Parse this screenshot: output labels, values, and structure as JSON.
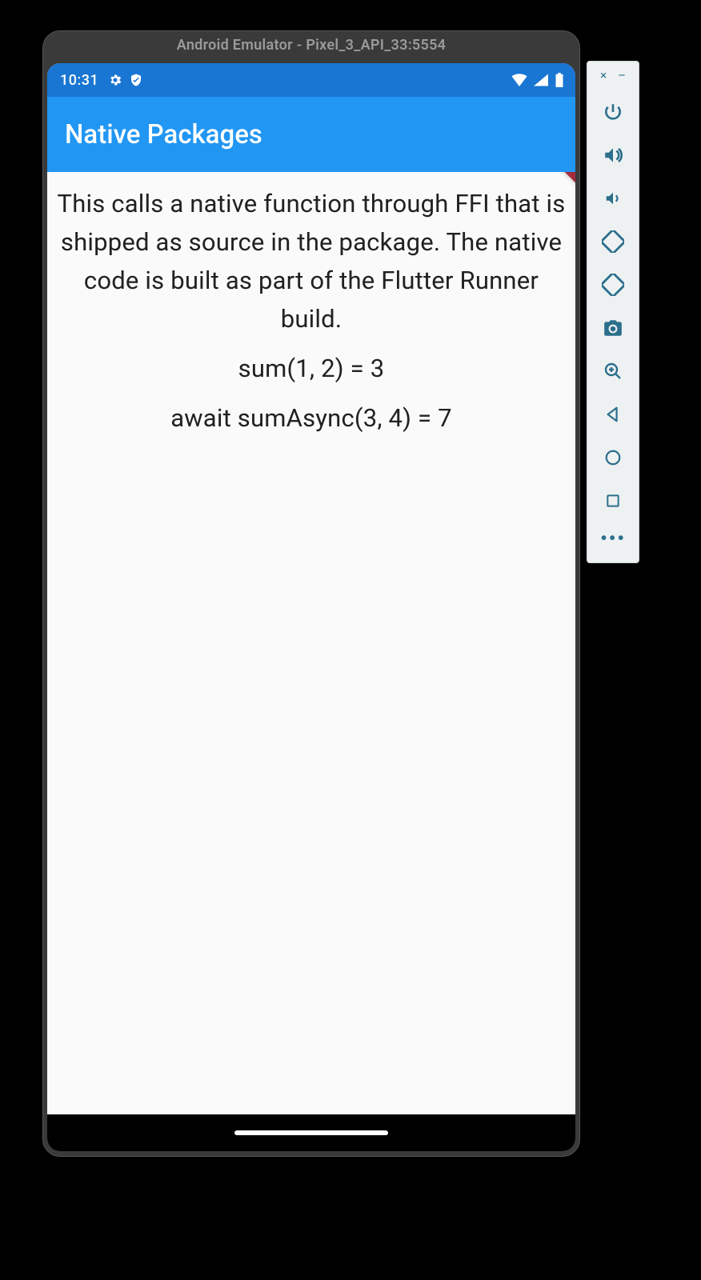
{
  "emulator": {
    "title": "Android Emulator - Pixel_3_API_33:5554",
    "toolbar": {
      "close": "×",
      "minimize": "–"
    }
  },
  "status_bar": {
    "time": "10:31"
  },
  "debug_banner": "DEBUG",
  "app_bar": {
    "title": "Native Packages"
  },
  "body": {
    "paragraph": "This calls a native function through FFI that is shipped as source in the package. The native code is built as part of the Flutter Runner build.",
    "line1": "sum(1, 2) = 3",
    "line2": "await sumAsync(3, 4) = 7"
  },
  "colors": {
    "status_bar": "#1976d2",
    "app_bar": "#2196f3",
    "toolbar_icon": "#2b6f8c",
    "debug_ribbon": "#a52a3a"
  }
}
